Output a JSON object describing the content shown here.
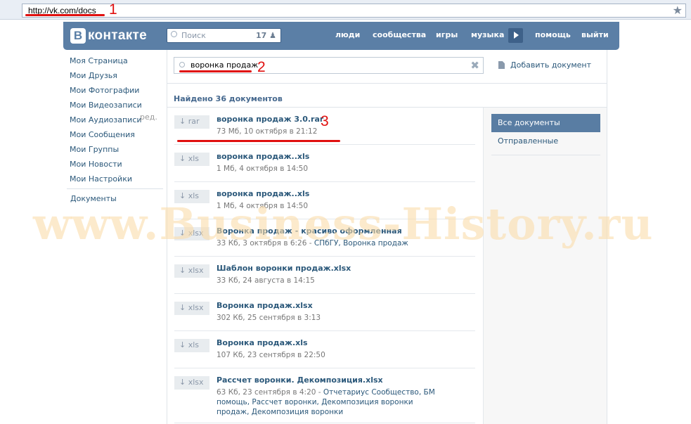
{
  "browser": {
    "url": "http://vk.com/docs",
    "bookmark_icon": "star-icon"
  },
  "annotations": [
    "1",
    "2",
    "3"
  ],
  "header": {
    "logo_letter": "В",
    "logo_text": "контакте",
    "search_placeholder": "Поиск",
    "notify_count": "17",
    "nav": [
      "люди",
      "сообщества",
      "игры",
      "музыка",
      "помощь",
      "выйти"
    ]
  },
  "sidebar": {
    "items": [
      {
        "label": "Моя Страница"
      },
      {
        "label": "Мои Друзья"
      },
      {
        "label": "Мои Фотографии"
      },
      {
        "label": "Мои Видеозаписи"
      },
      {
        "label": "Мои Аудиозаписи"
      },
      {
        "label": "Мои Сообщения"
      },
      {
        "label": "Мои Группы"
      },
      {
        "label": "Мои Новости"
      },
      {
        "label": "Мои Настройки"
      }
    ],
    "edit_label": "ред.",
    "documents_label": "Документы"
  },
  "docsearch": {
    "value": "воронка продаж",
    "add_label": "Добавить документ"
  },
  "results": {
    "found_label": "Найдено 36 документов"
  },
  "filters": {
    "active": "Все документы",
    "sent": "Отправленные"
  },
  "documents": [
    {
      "ext": "rar",
      "title": "воронка продаж 3.0.rar",
      "meta": "73 Мб, 10 октября в 21:12",
      "tags": ""
    },
    {
      "ext": "xls",
      "title": "воронка продаж..xls",
      "meta": "1 Мб, 4 октября в 14:50",
      "tags": ""
    },
    {
      "ext": "xls",
      "title": "воронка продаж..xls",
      "meta": "1 Мб, 4 октября в 14:50",
      "tags": ""
    },
    {
      "ext": "xlsx",
      "title": "Воронка продаж - красиво оформленная",
      "meta": "33 Кб, 3 октября в 6:26 - ",
      "tags": "СПбГУ, Воронка продаж"
    },
    {
      "ext": "xlsx",
      "title": "Шаблон воронки продаж.xlsx",
      "meta": "33 Кб, 24 августа в 14:15",
      "tags": ""
    },
    {
      "ext": "xlsx",
      "title": "Воронка продаж.xlsx",
      "meta": "302 Кб, 25 сентября в 3:13",
      "tags": ""
    },
    {
      "ext": "xls",
      "title": "Воронка продаж.xls",
      "meta": "107 Кб, 23 сентября в 22:50",
      "tags": ""
    },
    {
      "ext": "xlsx",
      "title": "Рассчет воронки. Декомпозиция.xlsx",
      "meta": "63 Кб, 23 сентября в 4:20 - ",
      "tags": "Отчетариус Сообщество, БМ помощь, Рассчет воронки, Декомпозиция воронки продаж, Декомпозиция воронки"
    }
  ],
  "watermark": "www.Business-History.ru",
  "colors": {
    "header_bg": "#5b7fa6",
    "link": "#2b587a",
    "annotation": "#e0100f",
    "watermark": "#fadcaa"
  }
}
